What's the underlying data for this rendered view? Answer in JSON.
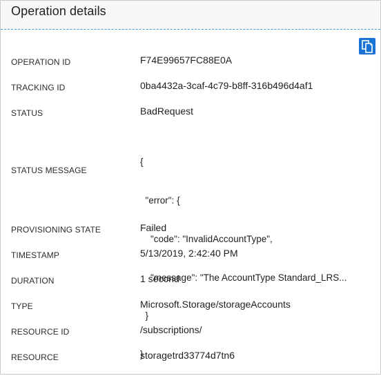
{
  "panel": {
    "title": "Operation details",
    "copy_button": {
      "icon": "copy-icon",
      "color": "#1a73d4"
    },
    "accent_color": "#3aa0d8"
  },
  "fields": {
    "operation_id": {
      "label": "OPERATION ID",
      "value": "F74E99657FC88E0A"
    },
    "tracking_id": {
      "label": "TRACKING ID",
      "value": "0ba4432a-3caf-4c79-b8ff-316b496d4af1"
    },
    "status": {
      "label": "STATUS",
      "value": "BadRequest"
    },
    "status_message": {
      "label": "STATUS MESSAGE",
      "lines": [
        "{",
        "  \"error\": {",
        "    \"code\": \"InvalidAccountType\",",
        "    \"message\": \"The AccountType Standard_LRS...",
        "  }",
        "}"
      ]
    },
    "provisioning_state": {
      "label": "PROVISIONING STATE",
      "value": "Failed"
    },
    "timestamp": {
      "label": "TIMESTAMP",
      "value": "5/13/2019, 2:42:40 PM"
    },
    "duration": {
      "label": "DURATION",
      "value": "1 second"
    },
    "type": {
      "label": "TYPE",
      "value": "Microsoft.Storage/storageAccounts"
    },
    "resource_id": {
      "label": "RESOURCE ID",
      "value": "/subscriptions/"
    },
    "resource": {
      "label": "RESOURCE",
      "value": "storagetrd33774d7tn6"
    }
  }
}
